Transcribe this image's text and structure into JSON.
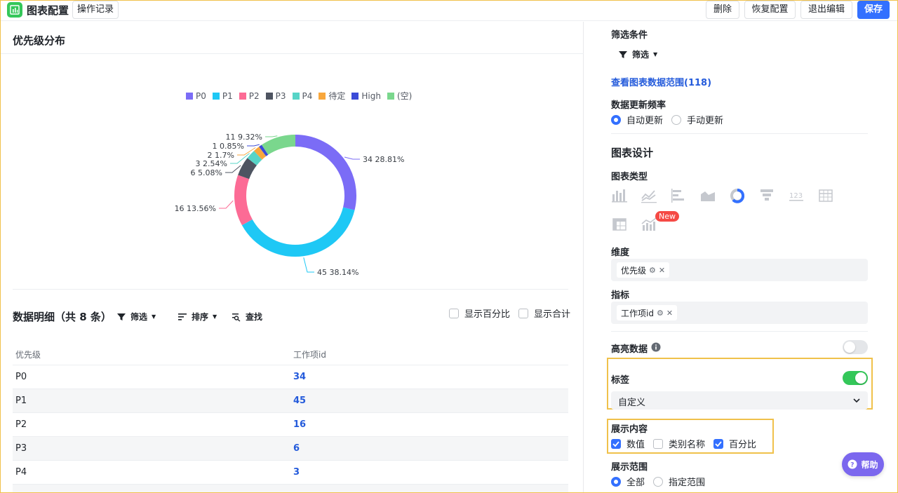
{
  "header": {
    "title": "图表配置",
    "history_label": "操作记录",
    "delete_label": "删除",
    "restore_label": "恢复配置",
    "exit_label": "退出编辑",
    "save_label": "保存"
  },
  "chart_section": {
    "title": "优先级分布"
  },
  "chart_data": {
    "type": "pie",
    "donut": true,
    "title": "优先级分布",
    "legend_position": "top",
    "categories": [
      "P0",
      "P1",
      "P2",
      "P3",
      "P4",
      "待定",
      "High",
      "(空)"
    ],
    "values": [
      34,
      45,
      16,
      6,
      3,
      2,
      1,
      11
    ],
    "percentages": [
      "28.81%",
      "38.14%",
      "13.56%",
      "5.08%",
      "2.54%",
      "1.7%",
      "0.85%",
      "9.32%"
    ],
    "colors": [
      "#7b6cf6",
      "#1ec8f5",
      "#fc6b95",
      "#4e5461",
      "#57d4c7",
      "#f8a73c",
      "#3b4bd8",
      "#7ad78d"
    ],
    "data_labels": [
      "34 28.81%",
      "45 38.14%",
      "16 13.56%",
      "6 5.08%",
      "3 2.54%",
      "2 1.7%",
      "1 0.85%",
      "11 9.32%"
    ]
  },
  "detail": {
    "title": "数据明细（共 8 条）",
    "filter_label": "筛选",
    "sort_label": "排序",
    "search_label": "查找",
    "show_percent_label": "显示百分比",
    "show_total_label": "显示合计",
    "columns": [
      "优先级",
      "工作项id"
    ],
    "rows": [
      {
        "name": "P0",
        "value": "34"
      },
      {
        "name": "P1",
        "value": "45"
      },
      {
        "name": "P2",
        "value": "16"
      },
      {
        "name": "P3",
        "value": "6"
      },
      {
        "name": "P4",
        "value": "3"
      }
    ]
  },
  "config": {
    "filter_title": "筛选条件",
    "filter_button": "筛选",
    "data_range_link": "查看图表数据范围(118)",
    "update_freq_title": "数据更新频率",
    "update_auto": "自动更新",
    "update_manual": "手动更新",
    "design_title": "图表设计",
    "chart_type_title": "图表类型",
    "new_badge": "New",
    "dimension_title": "维度",
    "dimension_tag": "优先级",
    "metric_title": "指标",
    "metric_tag": "工作项id",
    "highlight_title": "高亮数据",
    "label_title": "标签",
    "label_select_value": "自定义",
    "display_content_title": "展示内容",
    "content_value": "数值",
    "content_category": "类别名称",
    "content_percent": "百分比",
    "display_range_title": "展示范围",
    "range_all": "全部",
    "range_specific": "指定范围",
    "toggle_highlight_on": false,
    "toggle_label_on": true,
    "accent_color": "#3370ff",
    "toggle_on_color": "#34c759"
  },
  "help": {
    "label": "帮助"
  }
}
